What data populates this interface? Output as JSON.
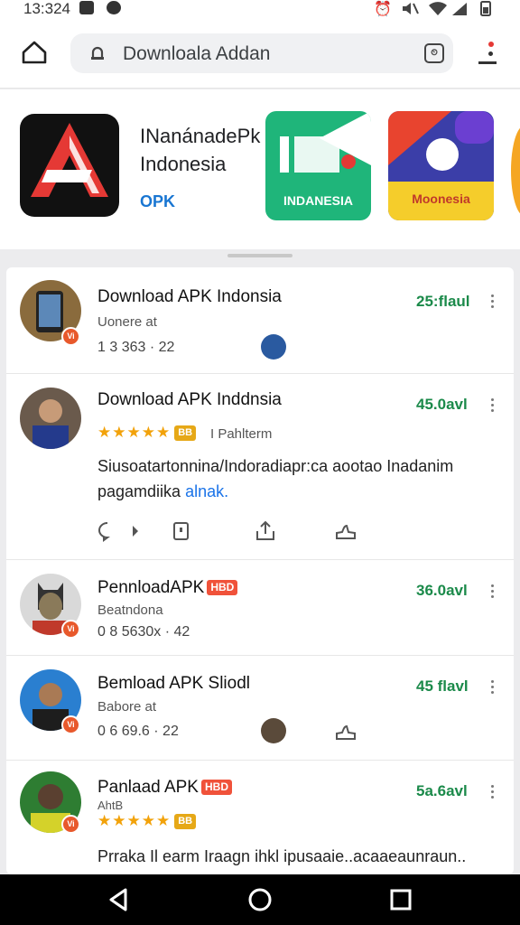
{
  "status": {
    "time": "13:324"
  },
  "browser": {
    "url": "Downloala Addan"
  },
  "featured": {
    "title": "INanánadePk Indonesia",
    "badge": "OPK",
    "tiles": [
      {
        "label": "INDANESIA",
        "color": "#1fb57a"
      },
      {
        "label": "Moonesia",
        "color": "#3b3ea8"
      }
    ]
  },
  "items": [
    {
      "title": "Download APK Indonsia",
      "sub": "Uonere at",
      "meta": "1 3 363 · 22",
      "right": "25:flaul",
      "verified": "Vi"
    },
    {
      "title": "Download APK Inddnsia",
      "rating_badge": "BB",
      "rating_label": "I Pahlterm",
      "description": "Siusoatartonnina/Indoradiapr:ca aootao Inadanim pagamdiika",
      "description_link": "alnak.",
      "right": "45.0avl",
      "verified": ""
    },
    {
      "title": "PennloadAPK",
      "hd": "HBD",
      "sub": "Beatndona",
      "meta": "0 8 5630x · 42",
      "right": "36.0avl",
      "verified": "Vi"
    },
    {
      "title": "Bemload APK Sliodl",
      "sub": "Babore at",
      "meta": "0 6 69.6 · 22",
      "right": "45 flavl",
      "verified": "Vi"
    },
    {
      "title": "Panlaad APK",
      "hd": "HBD",
      "sub": "AhtB",
      "rating_badge": "BB",
      "description": "Prraka Il earm Iraagn ihkl ipusaaie..acaaeaunraun..",
      "right": "5a.6avl",
      "verified": "Vi"
    }
  ],
  "colors": {
    "accent_green": "#1b8a4a",
    "link": "#1a73e8",
    "badge": "#f0523a"
  }
}
